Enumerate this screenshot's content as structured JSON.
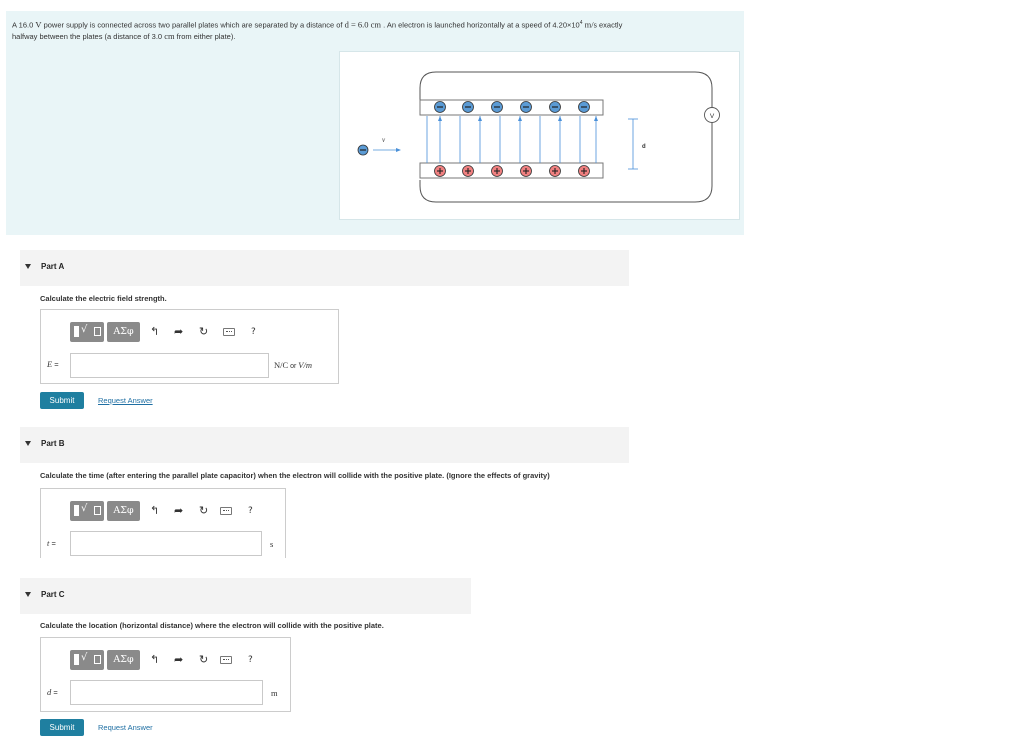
{
  "problem": {
    "t1": "A 16.0 ",
    "v_unit": "V",
    "t2": " power supply is connected across two parallel plates which are separated by a distance of ",
    "d_expr": "d = 6.0 cm",
    "t3": " . An electron is launched horizontally at a speed of 4.20×10",
    "exp": "4",
    "speed_unit": " m/s",
    "t4": " exactly",
    "line2a": "halfway between the plates (a distance of 3.0 ",
    "cm": "cm",
    "line2b": " from either plate)."
  },
  "figure": {
    "v_label": "v",
    "d_label": "d",
    "voltmeter_label": "V",
    "minus": "−",
    "plus": "+",
    "negative_color": "#5b9bd5",
    "positive_color": "#f08080",
    "arrow_color": "#4a90d9"
  },
  "toolbar": {
    "symbols": "ΑΣφ",
    "undo": "↰",
    "redo": "➦",
    "reset": "↻",
    "help": "?"
  },
  "parts": {
    "a": {
      "title": "Part A",
      "question": "Calculate the electric field strength.",
      "var": "E",
      "eq": " =",
      "unit_a": "N/C",
      "unit_or": " or ",
      "unit_b": "V/m",
      "submit": "Submit",
      "request": "Request Answer"
    },
    "b": {
      "title": "Part B",
      "question": "Calculate the time (after entering the parallel plate capacitor) when the electron will collide with the positive plate. (Ignore the effects of gravity)",
      "var": "t",
      "eq": " =",
      "unit": "s"
    },
    "c": {
      "title": "Part C",
      "question": "Calculate the location (horizontal distance) where the electron will collide with the positive plate.",
      "var": "d",
      "eq": " =",
      "unit": "m",
      "submit": "Submit",
      "request": "Request Answer"
    }
  }
}
